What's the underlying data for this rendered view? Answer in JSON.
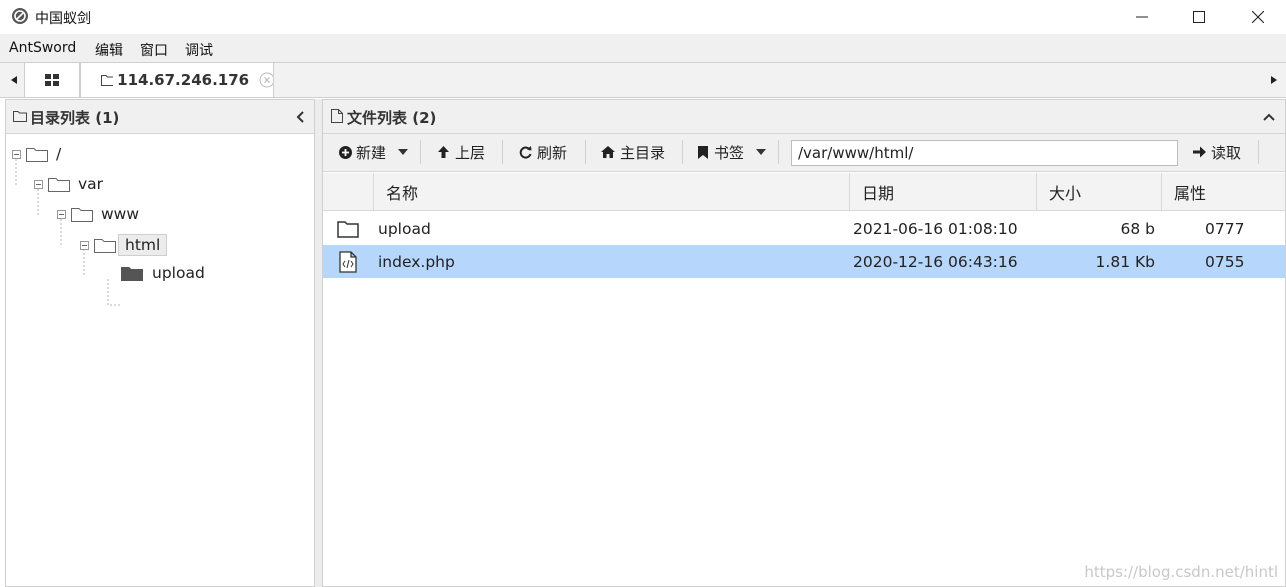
{
  "window": {
    "title": "中国蚁剑"
  },
  "menu": {
    "items": [
      "AntSword",
      "编辑",
      "窗口",
      "调试"
    ]
  },
  "tabs": {
    "active_label": "114.67.246.176"
  },
  "left_panel": {
    "title": "目录列表 (1)",
    "tree": [
      {
        "label": "/",
        "level": 0,
        "expanded": true
      },
      {
        "label": "var",
        "level": 1,
        "expanded": true
      },
      {
        "label": "www",
        "level": 2,
        "expanded": true
      },
      {
        "label": "html",
        "level": 3,
        "expanded": true,
        "selected": true
      },
      {
        "label": "upload",
        "level": 4,
        "expanded": false
      }
    ]
  },
  "right_panel": {
    "title": "文件列表 (2)",
    "toolbar": {
      "new_label": "新建",
      "up_label": "上层",
      "refresh_label": "刷新",
      "home_label": "主目录",
      "bookmark_label": "书签",
      "path_value": "/var/www/html/",
      "read_label": "读取"
    },
    "columns": [
      "名称",
      "日期",
      "大小",
      "属性"
    ],
    "rows": [
      {
        "icon": "folder-icon",
        "name": "upload",
        "date": "2021-06-16 01:08:10",
        "size": "68 b",
        "perm": "0777",
        "selected": false
      },
      {
        "icon": "php-file-icon",
        "name": "index.php",
        "date": "2020-12-16 06:43:16",
        "size": "1.81 Kb",
        "perm": "0755",
        "selected": true
      }
    ]
  },
  "watermark": "https://blog.csdn.net/hintl",
  "colors": {
    "selection": "#b6d7fb",
    "header_bg": "#f0f0f0"
  }
}
